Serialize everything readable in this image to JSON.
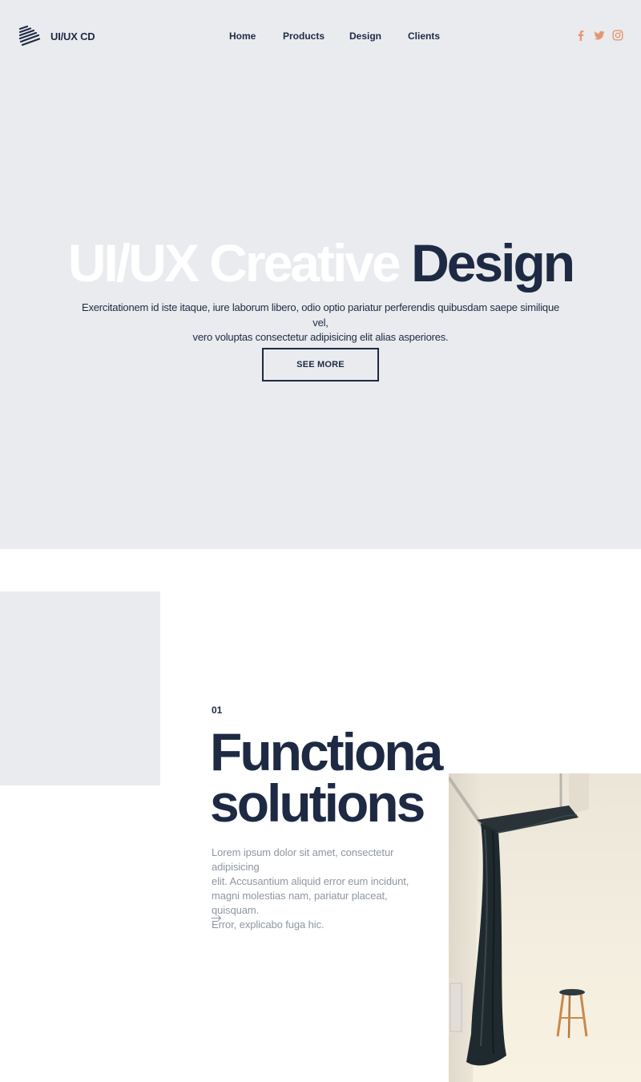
{
  "brand": {
    "name": "UI/UX CD",
    "logo_icon": "stacked-stripes-logo-icon"
  },
  "nav": {
    "items": [
      "Home",
      "Products",
      "Design",
      "Clients"
    ]
  },
  "social": {
    "icons": [
      "facebook-icon",
      "twitter-icon",
      "instagram-icon"
    ],
    "color": "#e8956e"
  },
  "hero": {
    "title_light": "UI/UX Creative",
    "title_dark": "Design",
    "description_line1": "Exercitationem id iste itaque, iure laborum libero, odio optio pariatur perferendis quibusdam saepe similique vel,",
    "description_line2": "vero voluptas consectetur adipisicing elit alias asperiores.",
    "cta_label": "SEE MORE"
  },
  "feature": {
    "number": "01",
    "title_line1": "Functiona",
    "title_line2": "solutions",
    "desc_lines": [
      "Lorem ipsum dolor sit amet, consectetur adipisicing",
      "elit. Accusantium aliquid error eum incidunt,",
      "magni molestias nam, pariatur placeat, quisquam.",
      "Error, explicabo fuga hic."
    ],
    "arrow_icon": "arrow-right-icon"
  },
  "colors": {
    "navy": "#1e2a44",
    "hero_bg": "#e9ebee",
    "accent": "#e8956e",
    "muted_text": "#8f96a2"
  }
}
